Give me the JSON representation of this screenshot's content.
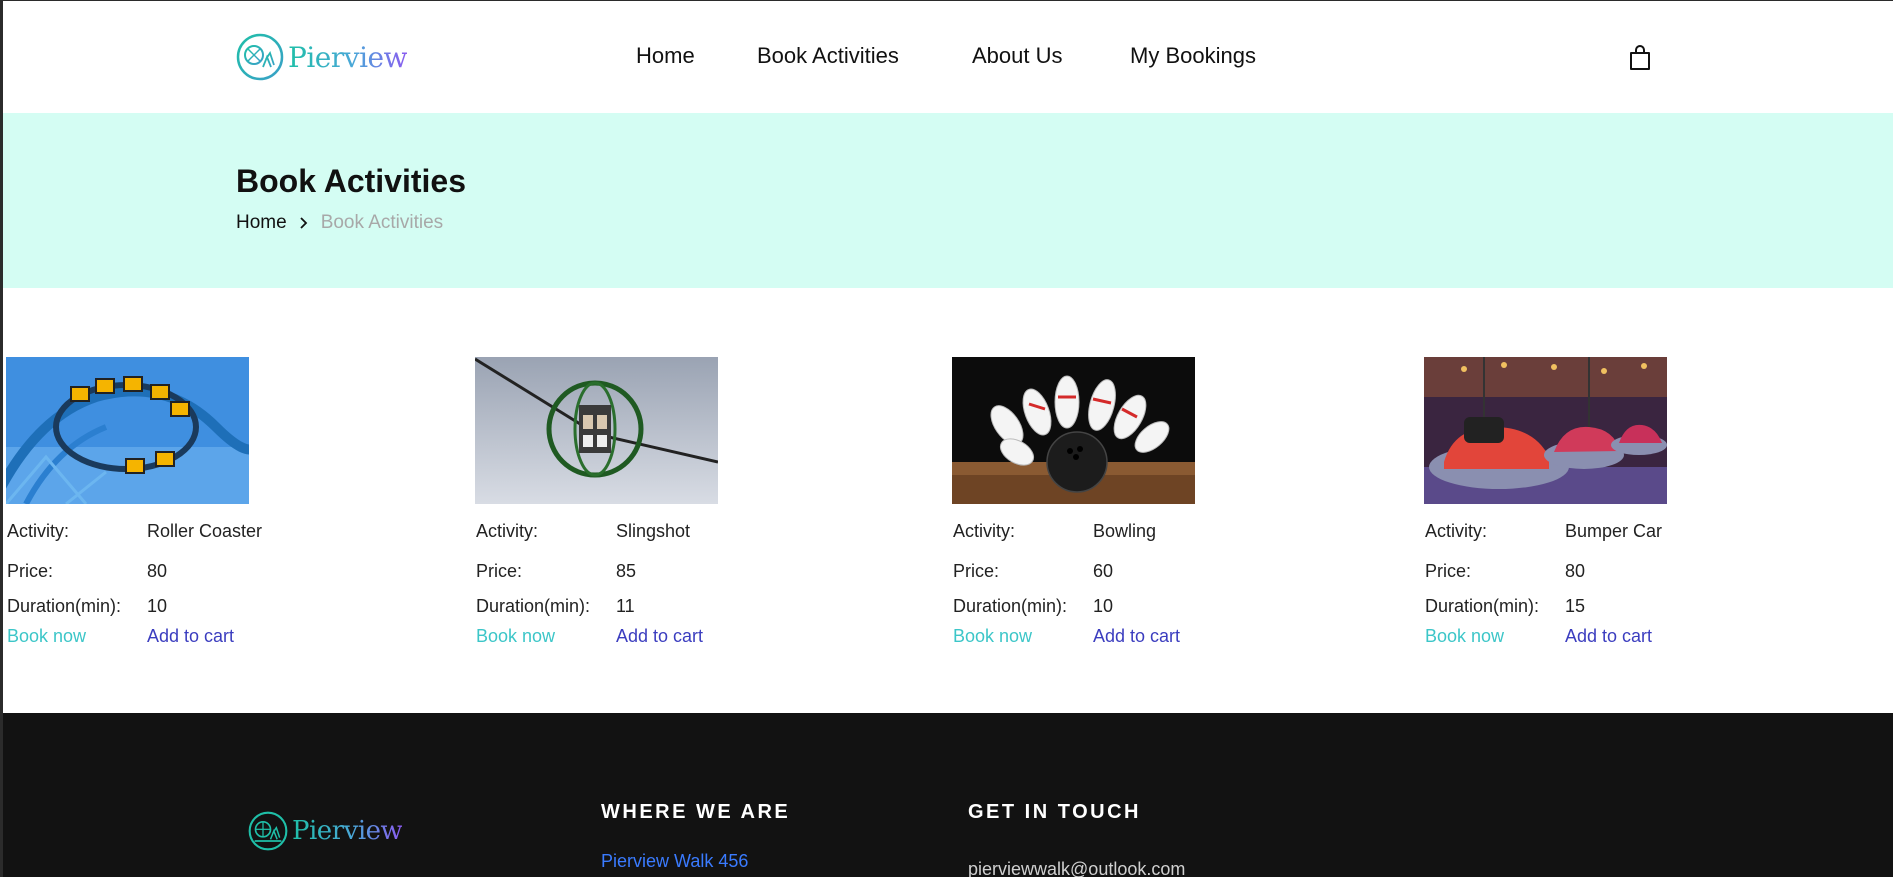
{
  "brand": {
    "name": "Pierview",
    "logo_icon": "ferris-wheel-icon",
    "colors": {
      "teal": "#1fbfa8",
      "purple": "#8a5cf0",
      "banner_bg": "#d4fdf3",
      "footer_bg": "#121212"
    }
  },
  "nav": {
    "items": [
      {
        "label": "Home"
      },
      {
        "label": "Book Activities"
      },
      {
        "label": "About Us"
      },
      {
        "label": "My Bookings"
      }
    ],
    "cart_icon": "shopping-bag-icon"
  },
  "banner": {
    "title": "Book Activities",
    "breadcrumb": {
      "home": "Home",
      "current": "Book Activities",
      "separator_icon": "chevron-right-icon"
    }
  },
  "activity_labels": {
    "activity": "Activity:",
    "price": "Price:",
    "duration": "Duration(min):",
    "book_now": "Book now",
    "add_to_cart": "Add to cart"
  },
  "activities": [
    {
      "name": "Roller Coaster",
      "price": "80",
      "duration": "10",
      "image": "roller-coaster-image"
    },
    {
      "name": "Slingshot",
      "price": "85",
      "duration": "11",
      "image": "slingshot-ride-image"
    },
    {
      "name": "Bowling",
      "price": "60",
      "duration": "10",
      "image": "bowling-pins-image"
    },
    {
      "name": "Bumper Car",
      "price": "80",
      "duration": "15",
      "image": "bumper-cars-image"
    }
  ],
  "footer": {
    "where_heading": "WHERE WE ARE",
    "address": "Pierview Walk 456",
    "touch_heading": "GET IN TOUCH",
    "email": "pierviewwalk@outlook.com"
  }
}
